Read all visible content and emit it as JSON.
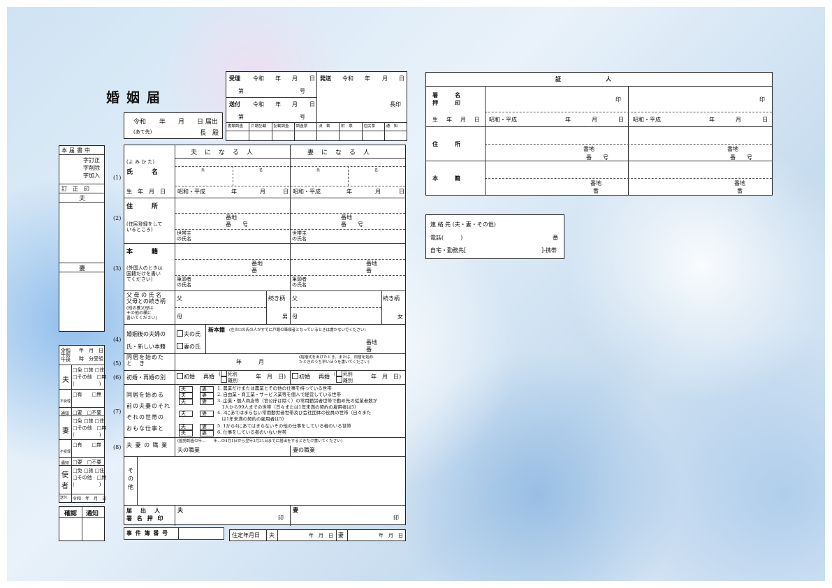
{
  "title": "婚姻届",
  "date_box": {
    "era": "令和",
    "year": "年",
    "month": "月",
    "day_submit": "日 届出",
    "addressee": "(あて先)",
    "chief": "長　殿"
  },
  "office": {
    "juri": "受理",
    "sofu": "送付",
    "hasso": "発送",
    "reiwa": "令和",
    "y": "年",
    "m": "月",
    "d": "日",
    "dai": "第",
    "go": "号",
    "chouin": "長印",
    "cells": [
      "書類調査",
      "戸籍記載",
      "記載調査",
      "調査票",
      "決　裁",
      "附　票",
      "住民票",
      "通　知"
    ]
  },
  "margin": {
    "header": "本届書中",
    "corrections": [
      "字訂正",
      "字削除",
      "字加入"
    ],
    "seal": "訂　正　印",
    "husband": "夫",
    "wife": "妻",
    "row_nums": [
      "(1)",
      "(2)",
      "(3)",
      "(4)",
      "(5)",
      "(6)",
      "(7)",
      "(8)"
    ]
  },
  "receipt": {
    "era": "令和",
    "ymd": "年　月　日",
    "ampm": "午前\n午後",
    "time": "時　分受領",
    "husband": "夫",
    "wife": "妻",
    "messenger": "使者",
    "ids": "□免 □旅 □住",
    "other": "□その他　□無",
    "paren": "(　　　　　)",
    "fushin": "不受理",
    "umu": "□有　　□無",
    "tsuchi": "通知",
    "yoh": "□要　□不要",
    "sofu": "送付",
    "sofu_date": "令和　年　月　日",
    "confirm": "確認",
    "notify": "通知"
  },
  "form": {
    "husband_head": "夫　に　な　る　人",
    "wife_head": "妻　に　な　る　人",
    "yomikata": "(よ み か た)",
    "shimei": "氏　　　名",
    "sei": "氏",
    "mei": "名",
    "birth_label": "生　年　月　日",
    "birth_val": "昭和・平成",
    "y": "年",
    "m": "月",
    "d": "日",
    "address_label": "住　　　所",
    "address_note": "(住民登録をして\nいるところ)",
    "banchi": "番地",
    "ban_go": "番　　号",
    "ban": "番",
    "setainushi": "世帯主\nの氏名",
    "honseki_label": "本　　　籍",
    "honseki_note": "(外国人のときは\n国籍だけを書い\nてください)",
    "hittosha": "筆頭者\nの氏名",
    "parents_label": "父 母 の 氏 名\n父母との続き柄",
    "parents_note": "(他の養父母は\nその他の欄に\n書いてください)",
    "father": "父",
    "mother": "母",
    "zokugara": "続き柄",
    "male": "男",
    "female": "女",
    "after_label1": "婚姻後の夫婦の",
    "after_label2": "氏・新しい本籍",
    "husband_surname": "夫の氏",
    "wife_surname": "妻の氏",
    "new_honseki": "新本籍",
    "new_honseki_note": "(左の☑の氏の人がすでに戸籍の筆頭者となっているときは書かないでください)",
    "cohab_label": "同居を始めた\nと　き",
    "cohab_ym": "年　　　月",
    "cohab_note": "(結婚式をあげたとき、または、同居を始め\nたときのうち早いほうを書いてください)",
    "marriage_label": "初婚・再婚の別",
    "first": "初婚",
    "re": "再婚",
    "shibetsu": "死別",
    "rikon": "離別",
    "ymd": "年　月　日)",
    "work_label": "同居を始める\n前の夫妻のそれ\nぞれの世帯の\nおもな仕事と",
    "fu": "夫",
    "tsuma": "妻",
    "work_items": [
      "1. 農業だけまたは農業とその他の仕事を持っている世帯",
      "2. 自由業・商工業・サービス業等を個人で経営している世帯",
      "3. 企業・個人商店等（官公庁は除く）の常用勤労者世帯で勤め先の従業者数が\n　1人から99人までの世帯（日々または1年未満の契約の雇用者は5）",
      "4. 3にあてはまらない常用勤労者世帯及び会社団体の役員の世帯（日々また\n　は1年未満の契約の雇用者は5）",
      "5. 1から4にあてはまらないその他の仕事をしている者のいる世帯",
      "6. 仕事をしている者のいない世帯"
    ],
    "job_label": "夫 妻 の 職 業",
    "job_note": "(国勢調査の年…　　年…の4月1日から翌年3月31日までに届出をするときだけ書いてください)",
    "husband_job": "夫の職業",
    "wife_job": "妻の職業",
    "other_label": "そ\nの\n他",
    "signer_label": "届　出　人\n署 名 押 印",
    "in": "印",
    "case_no": "事 件 簿 番 号",
    "residence_date": "住定年月日",
    "ymd_small": "年　月　日"
  },
  "witness": {
    "title": "証　　　　　　　　人",
    "sign_label1": "署　　　名",
    "sign_label2": "押　　　印",
    "in": "印",
    "birth_label": "生　年　月　日",
    "birth_val": "昭和・平成",
    "y": "年",
    "m": "月",
    "d": "日",
    "address_label": "住　　　所",
    "honseki_label": "本　　　籍",
    "banchi": "番地",
    "ban_go": "番　　号",
    "ban": "番"
  },
  "contact": {
    "title": "連 絡 先 (夫・妻・その他)",
    "phone": "電話(　　　)",
    "ban": "番",
    "home": "自宅・勤務先[",
    "mobile": "]-携帯"
  }
}
